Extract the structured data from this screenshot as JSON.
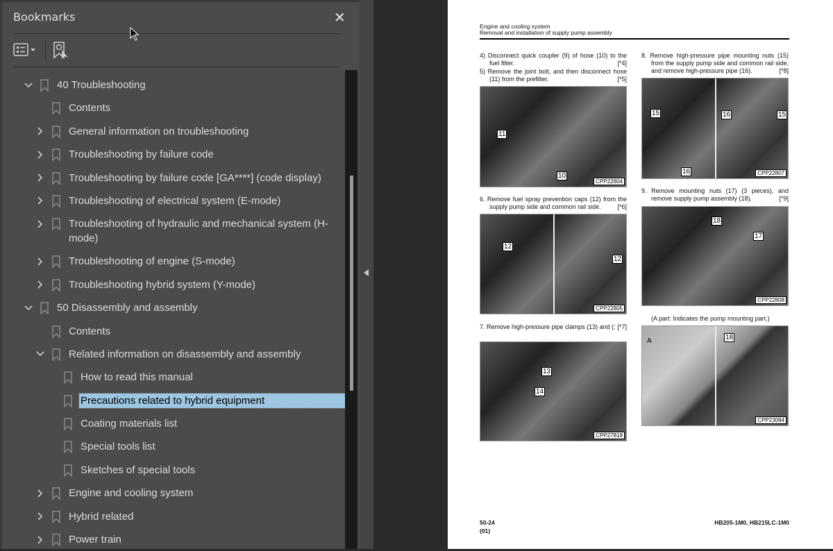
{
  "panel": {
    "title": "Bookmarks",
    "close_icon": "close-icon",
    "options_icon": "list-options-icon",
    "find_icon": "find-bookmark-icon"
  },
  "bookmarks": [
    {
      "label": "40 Troubleshooting",
      "level": 0,
      "state": "expanded"
    },
    {
      "label": "Contents",
      "level": 1,
      "state": "leaf"
    },
    {
      "label": "General information on troubleshooting",
      "level": 1,
      "state": "collapsed"
    },
    {
      "label": "Troubleshooting by failure code",
      "level": 1,
      "state": "collapsed"
    },
    {
      "label": "Troubleshooting by failure code [GA****] (code display)",
      "level": 1,
      "state": "collapsed"
    },
    {
      "label": "Troubleshooting of electrical system (E-mode)",
      "level": 1,
      "state": "collapsed"
    },
    {
      "label": "Troubleshooting of hydraulic and mechanical system (H-mode)",
      "level": 1,
      "state": "collapsed"
    },
    {
      "label": "Troubleshooting of engine (S-mode)",
      "level": 1,
      "state": "collapsed"
    },
    {
      "label": "Troubleshooting hybrid system (Y-mode)",
      "level": 1,
      "state": "collapsed"
    },
    {
      "label": "50 Disassembly and assembly",
      "level": 0,
      "state": "expanded"
    },
    {
      "label": "Contents",
      "level": 1,
      "state": "leaf"
    },
    {
      "label": "Related information on disassembly and assembly",
      "level": 1,
      "state": "expanded"
    },
    {
      "label": "How to read this manual",
      "level": 2,
      "state": "leaf"
    },
    {
      "label": "Precautions related to hybrid equipment",
      "level": 2,
      "state": "leaf",
      "selected": true
    },
    {
      "label": "Coating materials list",
      "level": 2,
      "state": "leaf"
    },
    {
      "label": "Special tools list",
      "level": 2,
      "state": "leaf"
    },
    {
      "label": "Sketches of special tools",
      "level": 2,
      "state": "leaf"
    },
    {
      "label": "Engine and cooling system",
      "level": 1,
      "state": "collapsed"
    },
    {
      "label": "Hybrid related",
      "level": 1,
      "state": "collapsed"
    },
    {
      "label": "Power train",
      "level": 1,
      "state": "collapsed"
    }
  ],
  "colors": {
    "selection": "#9cc6e2",
    "panel_bg": "#4b4b4b"
  },
  "scrollbar": {
    "position_fraction": 0.22,
    "visible_fraction": 0.45
  },
  "page": {
    "header1": "Engine and cooling system",
    "header2": "Removal and installation of supply pump assembly",
    "steps": {
      "s4": {
        "text": "4) Disconnect quick coupler (9) of hose (10) to the fuel filter.",
        "ref": "[*4]"
      },
      "s5": {
        "text": "5) Remove the joint bolt, and then disconnect hose (11) from the prefilter.",
        "ref": "[*5]"
      },
      "s6": {
        "text": "6. Remove fuel spray prevention caps (12) from the supply pump side and common rail side.",
        "ref": "[*6]"
      },
      "s7": {
        "text": "7. Remove high-pressure pipe clamps (13) and (14).",
        "ref": "[*7]"
      },
      "s8": {
        "text": "8. Remove high-pressure pipe mounting nuts (15) from the supply pump side and common rail side, and remove high-pressure pipe (16).",
        "ref": "[*8]"
      },
      "s9": {
        "text": "9. Remove mounting nuts (17) (3 pieces), and remove supply pump assembly (18).",
        "ref": "[*9]"
      },
      "note": "(A part: Indicates the pump mounting part.)"
    },
    "photos": {
      "p1": {
        "code": "CPP22804",
        "labels": [
          "11",
          "10"
        ]
      },
      "p2": {
        "code": "CPP22807",
        "labels": [
          "15",
          "16",
          "16",
          "15"
        ]
      },
      "p3": {
        "code": "CPP22805",
        "labels": [
          "12",
          "12"
        ]
      },
      "p4": {
        "code": "CPP22808",
        "labels": [
          "18",
          "17"
        ]
      },
      "p5": {
        "code": "CPP27818",
        "labels": [
          "13",
          "14"
        ]
      },
      "p6": {
        "code": "CPP23084",
        "labels": [
          "A",
          "18"
        ]
      }
    },
    "footer_page": "50-24",
    "footer_rev": "(01)",
    "footer_model": "HB205-1M0, HB215LC-1M0"
  }
}
